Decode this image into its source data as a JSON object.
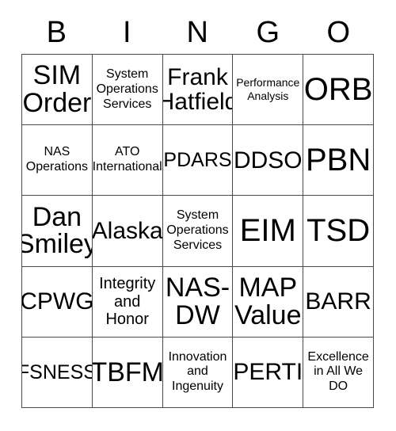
{
  "card": {
    "title": "BINGO",
    "header_letters": [
      "B",
      "I",
      "N",
      "G",
      "O"
    ],
    "border_color": "#4a4a4a",
    "background_color": "#ffffff",
    "text_color": "#000000",
    "columns": 5,
    "rows": 5,
    "cells": [
      {
        "text": "SIM\nOrder",
        "size": "xl"
      },
      {
        "text": "System\nOperations\nServices",
        "size": "xs"
      },
      {
        "text": "Frank\nHatfield",
        "size": "lg"
      },
      {
        "text": "Performance\nAnalysis",
        "size": "xxs"
      },
      {
        "text": "ORB",
        "size": "xxl"
      },
      {
        "text": "NAS\nOperations",
        "size": "xs"
      },
      {
        "text": "ATO\nInternational",
        "size": "xs"
      },
      {
        "text": "PDARS",
        "size": "md"
      },
      {
        "text": "DDSO",
        "size": "lg"
      },
      {
        "text": "PBN",
        "size": "xxl"
      },
      {
        "text": "Dan\nSmiley",
        "size": "xl"
      },
      {
        "text": "Alaska",
        "size": "lg"
      },
      {
        "text": "System\nOperations\nServices",
        "size": "xs"
      },
      {
        "text": "EIM",
        "size": "xxl"
      },
      {
        "text": "TSD",
        "size": "xxl"
      },
      {
        "text": "CPWG",
        "size": "lg"
      },
      {
        "text": "Integrity\nand\nHonor",
        "size": "sm"
      },
      {
        "text": "NAS-\nDW",
        "size": "xl"
      },
      {
        "text": "MAP\nValue",
        "size": "xl"
      },
      {
        "text": "BARR",
        "size": "lg"
      },
      {
        "text": "FSNESS",
        "size": "md"
      },
      {
        "text": "TBFM",
        "size": "xl"
      },
      {
        "text": "Innovation\nand\nIngenuity",
        "size": "xs"
      },
      {
        "text": "PERTI",
        "size": "lg"
      },
      {
        "text": "Excellence\nin All We\nDO",
        "size": "xs"
      }
    ]
  }
}
